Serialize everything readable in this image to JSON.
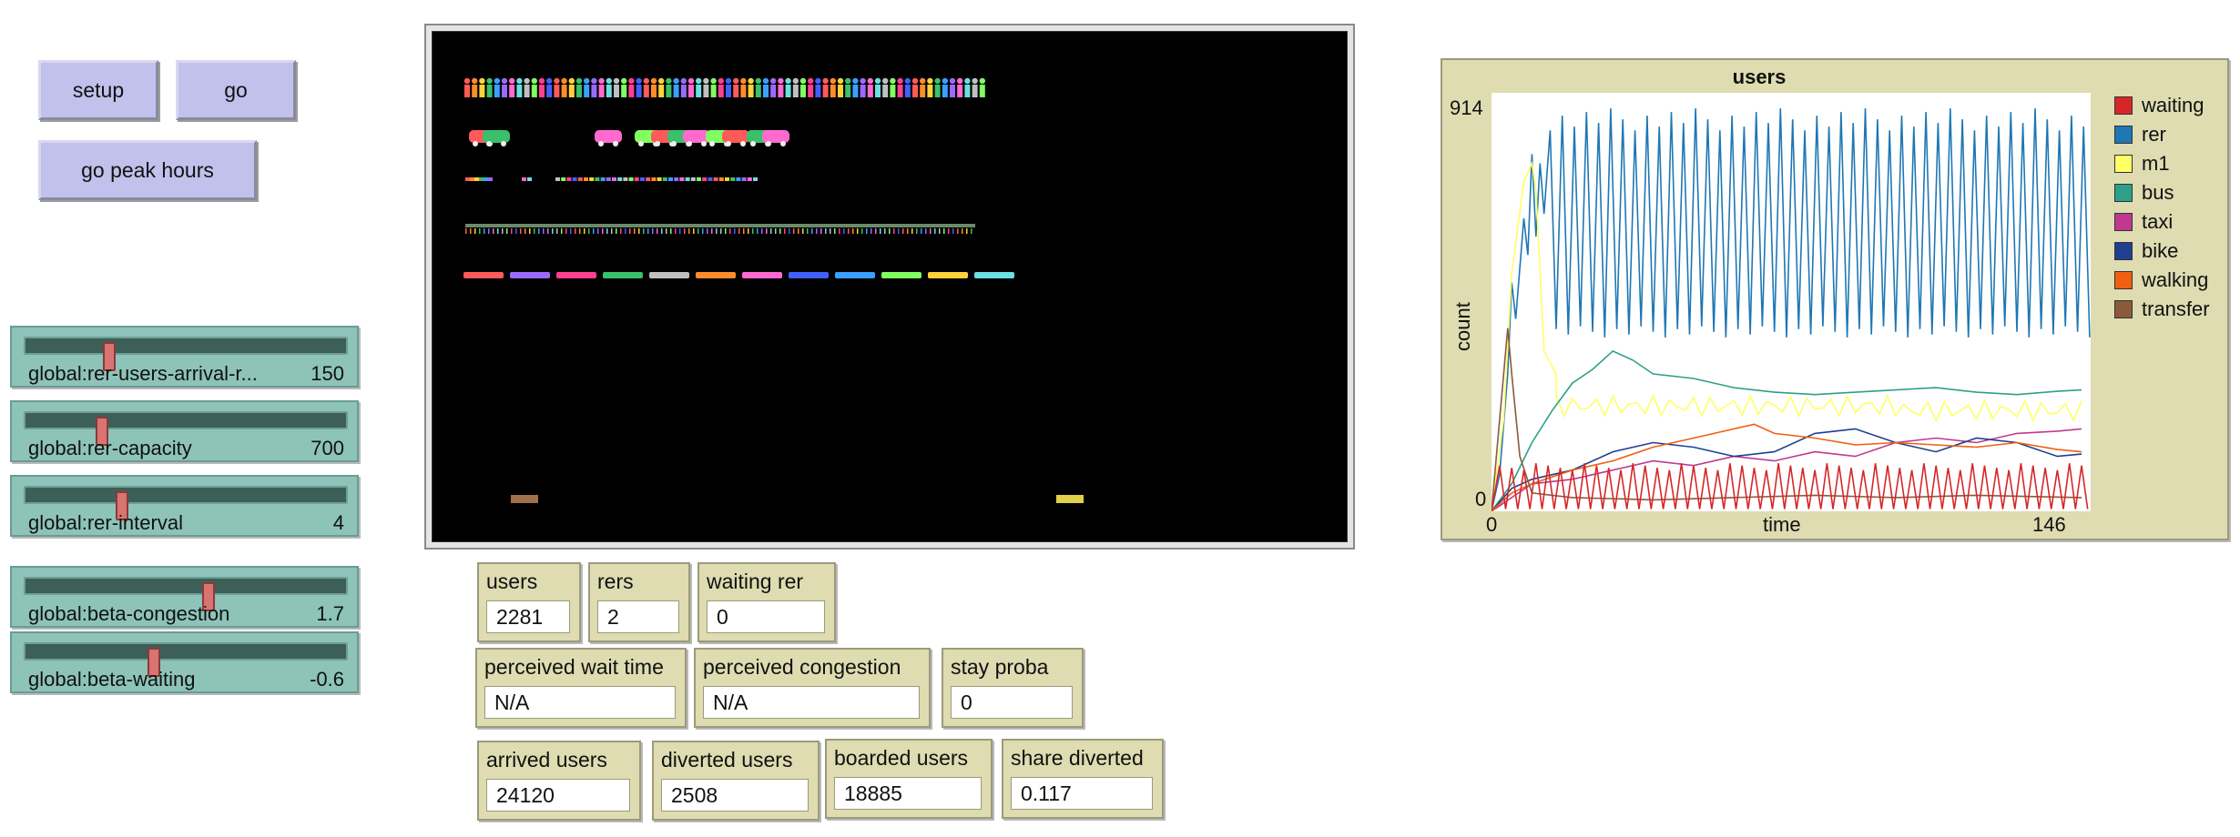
{
  "buttons": {
    "setup": "setup",
    "go": "go",
    "go_peak": "go peak hours"
  },
  "sliders": [
    {
      "label": "global:rer-users-arrival-r...",
      "value": "150",
      "fraction": 0.26
    },
    {
      "label": "global:rer-capacity",
      "value": "700",
      "fraction": 0.24
    },
    {
      "label": "global:rer-interval",
      "value": "4",
      "fraction": 0.3
    },
    {
      "label": "global:beta-congestion",
      "value": "1.7",
      "fraction": 0.57
    },
    {
      "label": "global:beta-waiting",
      "value": "-0.6",
      "fraction": 0.4
    }
  ],
  "monitors": [
    {
      "label": "users",
      "value": "2281"
    },
    {
      "label": "rers",
      "value": "2"
    },
    {
      "label": "waiting rer",
      "value": "0"
    },
    {
      "label": "perceived wait time",
      "value": "N/A"
    },
    {
      "label": "perceived congestion",
      "value": "N/A"
    },
    {
      "label": "stay proba",
      "value": "0"
    },
    {
      "label": "arrived users",
      "value": "24120"
    },
    {
      "label": "diverted users",
      "value": "2508"
    },
    {
      "label": "boarded users",
      "value": "18885"
    },
    {
      "label": "share diverted",
      "value": "0.117"
    }
  ],
  "plot": {
    "title": "users",
    "ymax": "914",
    "ymin": "0",
    "xmin": "0",
    "xmax": "146",
    "xlabel": "time",
    "ylabel": "count"
  },
  "chart_data": {
    "type": "line",
    "title": "users",
    "xlabel": "time",
    "ylabel": "count",
    "xlim": [
      0,
      146
    ],
    "ylim": [
      0,
      914
    ],
    "grid": false,
    "legend_position": "right",
    "series": [
      {
        "name": "waiting",
        "color": "#d62728"
      },
      {
        "name": "rer",
        "color": "#1f77b4"
      },
      {
        "name": "m1",
        "color": "#ffff66"
      },
      {
        "name": "bus",
        "color": "#2ca08a"
      },
      {
        "name": "taxi",
        "color": "#c0398f"
      },
      {
        "name": "bike",
        "color": "#1f3f8f"
      },
      {
        "name": "walking",
        "color": "#f06010"
      },
      {
        "name": "transfer",
        "color": "#8b5a3c"
      }
    ]
  }
}
